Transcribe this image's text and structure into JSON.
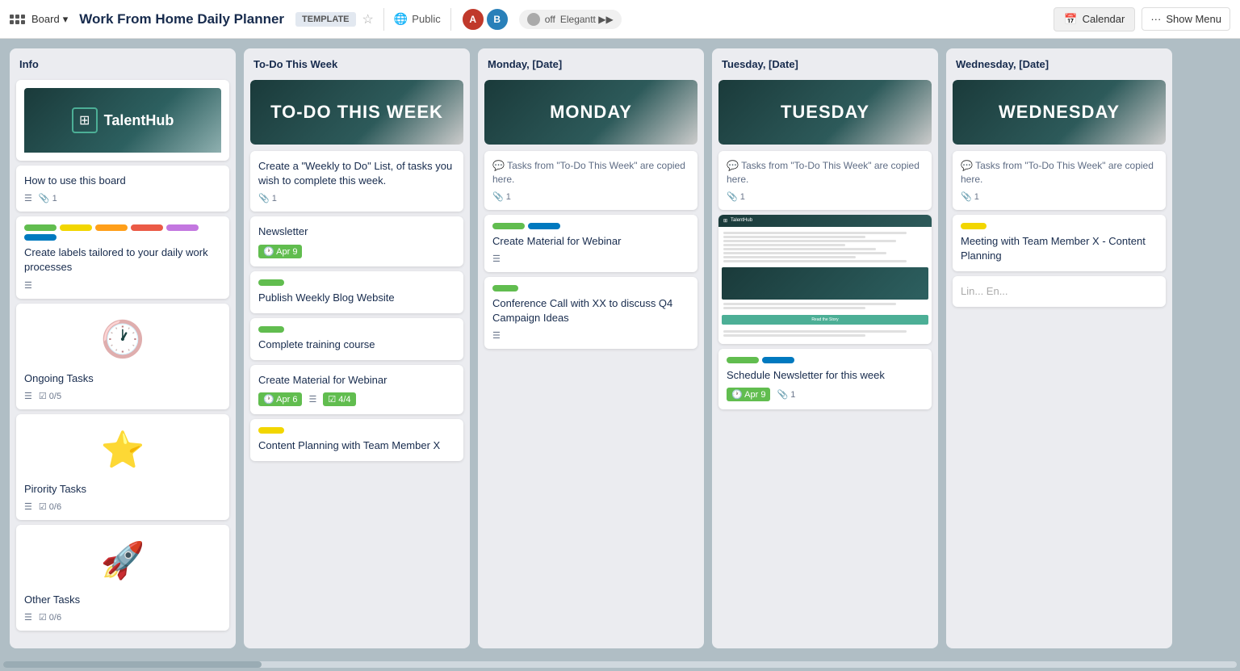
{
  "topbar": {
    "board_label": "Board",
    "title": "Work From Home Daily Planner",
    "template_badge": "TEMPLATE",
    "visibility": "Public",
    "toggle_label": "off",
    "toggle_brand": "Elegantt ▶▶",
    "calendar_btn": "Calendar",
    "menu_btn": "Show Menu"
  },
  "columns": [
    {
      "id": "info",
      "header": "Info",
      "cards": [
        {
          "id": "talenthub-logo",
          "type": "logo-banner"
        },
        {
          "id": "how-to",
          "title": "How to use this board",
          "meta": [
            {
              "type": "lines"
            },
            {
              "type": "attachment",
              "count": "1"
            }
          ]
        },
        {
          "id": "labels-card",
          "labels": [
            "green",
            "yellow",
            "orange",
            "red",
            "purple",
            "blue"
          ],
          "title": "Create labels tailored to your daily work processes",
          "meta": [
            {
              "type": "lines"
            }
          ]
        },
        {
          "id": "ongoing-tasks",
          "icon": "🕐",
          "icon_color": "#00bcd4",
          "title": "Ongoing Tasks",
          "meta": [
            {
              "type": "lines"
            },
            {
              "type": "checklist",
              "value": "0/5"
            }
          ]
        },
        {
          "id": "priority-tasks",
          "icon": "⭐",
          "title": "Pirority Tasks",
          "meta": [
            {
              "type": "lines"
            },
            {
              "type": "checklist",
              "value": "0/6"
            }
          ]
        },
        {
          "id": "other-tasks",
          "icon": "🚀",
          "title": "Other Tasks",
          "meta": [
            {
              "type": "lines"
            },
            {
              "type": "checklist",
              "value": "0/6"
            }
          ]
        }
      ]
    },
    {
      "id": "todo",
      "header": "To-Do This Week",
      "banner_text": "TO-DO THIS WEEK",
      "cards": [
        {
          "id": "weekly-list",
          "title": "Create a \"Weekly to Do\" List, of tasks you wish to complete this week.",
          "meta": [
            {
              "type": "attachment",
              "count": "1"
            }
          ]
        },
        {
          "id": "newsletter",
          "title": "Newsletter",
          "meta": [
            {
              "type": "date-badge",
              "date": "Apr 9"
            }
          ]
        },
        {
          "id": "publish-blog",
          "labels": [
            "green-sm"
          ],
          "title": "Publish Weekly Blog Website"
        },
        {
          "id": "complete-training",
          "labels": [
            "green-sm"
          ],
          "title": "Complete training course"
        },
        {
          "id": "create-webinar",
          "title": "Create Material for Webinar",
          "meta": [
            {
              "type": "date-badge",
              "date": "Apr 6"
            },
            {
              "type": "lines"
            },
            {
              "type": "checklist-badge",
              "value": "4/4"
            }
          ]
        },
        {
          "id": "content-planning",
          "labels": [
            "yellow-sm"
          ],
          "title": "Content Planning with Team Member X"
        }
      ]
    },
    {
      "id": "monday",
      "header": "Monday, [Date]",
      "banner_text": "MONDAY",
      "cards": [
        {
          "id": "monday-note",
          "has_chat": true,
          "desc": "Tasks from \"To-Do This Week\" are copied here.",
          "meta": [
            {
              "type": "attachment",
              "count": "1"
            }
          ]
        },
        {
          "id": "webinar-material",
          "labels": [
            "green",
            "blue"
          ],
          "title": "Create Material for Webinar",
          "meta": [
            {
              "type": "lines"
            }
          ]
        },
        {
          "id": "conference-call",
          "labels": [
            "green-sm"
          ],
          "title": "Conference Call with XX to discuss Q4 Campaign Ideas",
          "meta": [
            {
              "type": "lines"
            }
          ]
        }
      ]
    },
    {
      "id": "tuesday",
      "header": "Tuesday, [Date]",
      "banner_text": "TUESDAY",
      "cards": [
        {
          "id": "tuesday-note",
          "has_chat": true,
          "desc": "Tasks from \"To-Do This Week\" are copied here.",
          "meta": [
            {
              "type": "attachment",
              "count": "1"
            }
          ]
        },
        {
          "id": "newsletter-image",
          "type": "newsletter-image"
        },
        {
          "id": "schedule-newsletter",
          "labels": [
            "green",
            "blue"
          ],
          "title": "Schedule Newsletter for this week",
          "meta": [
            {
              "type": "date-badge",
              "date": "Apr 9"
            },
            {
              "type": "attachment",
              "count": "1"
            }
          ]
        }
      ]
    },
    {
      "id": "wednesday",
      "header": "Wednesday, [Date]",
      "banner_text": "WEDNESDAY",
      "cards": [
        {
          "id": "wednesday-note",
          "has_chat": true,
          "desc": "Tasks from \"To-Do This Week\" are copied here.",
          "meta": [
            {
              "type": "attachment",
              "count": "1"
            }
          ]
        },
        {
          "id": "meeting-content",
          "labels": [
            "yellow-sm"
          ],
          "title": "Meeting with Team Member X - Content Planning"
        },
        {
          "id": "wednesday-extra",
          "title": "Lin... En..."
        }
      ]
    }
  ]
}
